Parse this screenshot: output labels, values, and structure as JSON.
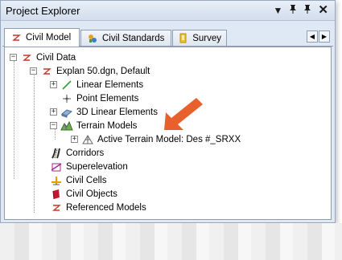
{
  "window": {
    "title": "Project Explorer"
  },
  "titlebar_icons": [
    "dropdown-icon",
    "pin-icon",
    "autohide-icon",
    "close-icon"
  ],
  "tabs": [
    {
      "label": "Civil Model",
      "icon": "civil-model-icon",
      "active": true
    },
    {
      "label": "Civil Standards",
      "icon": "civil-standards-icon",
      "active": false
    },
    {
      "label": "Survey",
      "icon": "survey-icon",
      "active": false
    }
  ],
  "tree": {
    "root": {
      "label": "Civil Data",
      "expander": "−"
    },
    "model": {
      "label": "Explan 50.dgn, Default",
      "expander": "−"
    },
    "items": [
      {
        "label": "Linear Elements",
        "expander": "+",
        "icon": "linear-elements-icon"
      },
      {
        "label": "Point Elements",
        "expander": "",
        "icon": "point-elements-icon"
      },
      {
        "label": "3D Linear Elements",
        "expander": "+",
        "icon": "3d-linear-elements-icon"
      },
      {
        "label": "Terrain Models",
        "expander": "−",
        "icon": "terrain-models-icon"
      },
      {
        "label": "Active Terrain Model: Des #_SRXX",
        "expander": "+",
        "icon": "active-terrain-model-icon"
      },
      {
        "label": "Corridors",
        "expander": "",
        "icon": "corridors-icon"
      },
      {
        "label": "Superelevation",
        "expander": "",
        "icon": "superelevation-icon"
      },
      {
        "label": "Civil Cells",
        "expander": "",
        "icon": "civil-cells-icon"
      },
      {
        "label": "Civil Objects",
        "expander": "",
        "icon": "civil-objects-icon"
      },
      {
        "label": "Referenced Models",
        "expander": "",
        "icon": "referenced-models-icon"
      }
    ]
  },
  "colors": {
    "annotation_arrow": "#e8602c",
    "panel_bg": "#dfe9f5"
  }
}
